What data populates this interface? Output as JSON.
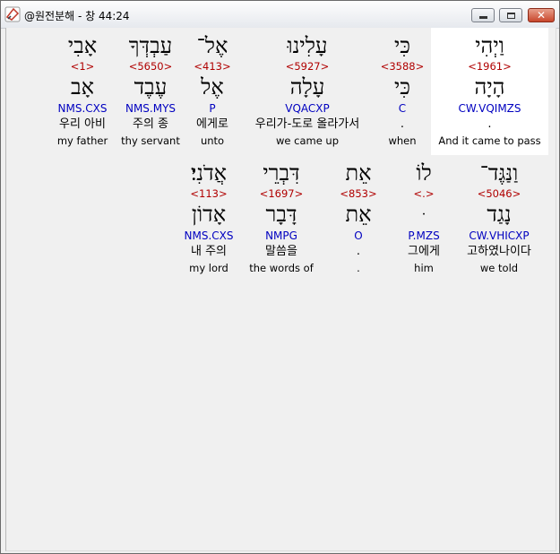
{
  "window": {
    "title": "@원전분해 - 창 44:24",
    "min_label": "",
    "max_label": "",
    "close_label": "✕"
  },
  "rows": [
    [
      {
        "heb": "וַיְהִי",
        "strong": "<1961>",
        "root": "הָיָה",
        "morph": "CW.VQIMZS",
        "kor": ".",
        "eng": "And it came to pass",
        "highlight": true
      },
      {
        "heb": "כִּי",
        "strong": "<3588>",
        "root": "כִּי",
        "morph": "C",
        "kor": ".",
        "eng": "when",
        "highlight": false
      },
      {
        "heb": "עָלִינוּ",
        "strong": "<5927>",
        "root": "עָלָה",
        "morph": "VQACXP",
        "kor": "우리가-도로 올라가서",
        "eng": "we came up",
        "highlight": false
      },
      {
        "heb": "אֶל־",
        "strong": "<413>",
        "root": "אֶל",
        "morph": "P",
        "kor": "에게로",
        "eng": "unto",
        "highlight": false
      },
      {
        "heb": "עַבְדְּךָ",
        "strong": "<5650>",
        "root": "עֶבֶד",
        "morph": "NMS.MYS",
        "kor": "주의 종",
        "eng": "thy servant",
        "highlight": false
      },
      {
        "heb": "אָבִי",
        "strong": "<1>",
        "root": "אָב",
        "morph": "NMS.CXS",
        "kor": "우리 아비",
        "eng": "my father",
        "highlight": false
      }
    ],
    [
      {
        "heb": "וַנַּגֶּד־",
        "strong": "<5046>",
        "root": "נָגַד",
        "morph": "CW.VHICXP",
        "kor": "고하였나이다",
        "eng": "we told",
        "highlight": false
      },
      {
        "heb": "לוֹ",
        "strong": "<.>",
        "root": "ּ",
        "morph": "P.MZS",
        "kor": "그에게",
        "eng": "him",
        "highlight": false
      },
      {
        "heb": "אֵת",
        "strong": "<853>",
        "root": "אֵת",
        "morph": "O",
        "kor": ".",
        "eng": ".",
        "highlight": false
      },
      {
        "heb": "דִּבְרֵי",
        "strong": "<1697>",
        "root": "דָּבָר",
        "morph": "NMPG",
        "kor": "말씀을",
        "eng": "the words of",
        "highlight": false
      },
      {
        "heb": "אֲדֹנִי׃",
        "strong": "<113>",
        "root": "אָדוֹן",
        "morph": "NMS.CXS",
        "kor": "내 주의",
        "eng": "my lord",
        "highlight": false
      }
    ]
  ]
}
